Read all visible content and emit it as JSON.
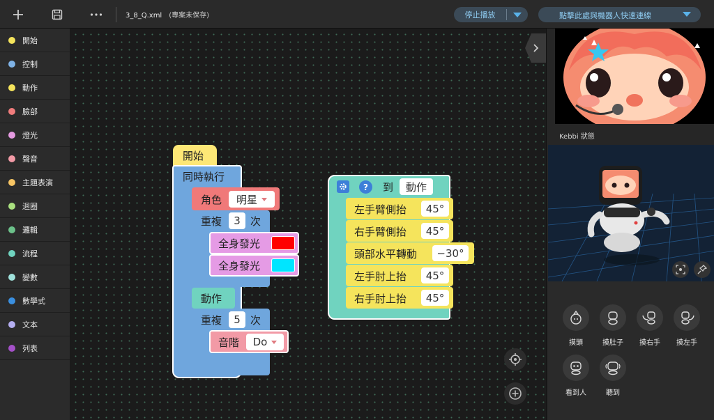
{
  "toolbar": {
    "add_icon": "plus-icon",
    "save_icon": "floppy-icon",
    "more_icon": "ellipsis-icon",
    "filename": "3_8_Q.xml",
    "save_status": "(專案未保存)",
    "stop_label": "停止播放",
    "connect_label": "點擊此處與機器人快速連線"
  },
  "sidebar": {
    "items": [
      {
        "label": "開始",
        "color": "#f5e45c"
      },
      {
        "label": "控制",
        "color": "#7fb2e5"
      },
      {
        "label": "動作",
        "color": "#f5e45c"
      },
      {
        "label": "臉部",
        "color": "#f07c7c"
      },
      {
        "label": "燈光",
        "color": "#e49ae0"
      },
      {
        "label": "聲音",
        "color": "#f29aa6"
      },
      {
        "label": "主題表演",
        "color": "#f7c564"
      },
      {
        "label": "迴圈",
        "color": "#a9e07f"
      },
      {
        "label": "邏輯",
        "color": "#6cc18a"
      },
      {
        "label": "流程",
        "color": "#70d3bf"
      },
      {
        "label": "變數",
        "color": "#9fe1db"
      },
      {
        "label": "數學式",
        "color": "#3a8fe0"
      },
      {
        "label": "文本",
        "color": "#b4aef0"
      },
      {
        "label": "列表",
        "color": "#a450c8"
      }
    ]
  },
  "blocks": {
    "start": "開始",
    "parallel": "同時執行",
    "role_label": "角色",
    "role_value": "明星",
    "repeat1_label": "重複",
    "repeat1_count": "3",
    "repeat1_unit": "次",
    "light1_label": "全身發光",
    "light1_color": "#ff0000",
    "light2_label": "全身發光",
    "light2_color": "#00e5ff",
    "action_label": "動作",
    "repeat2_label": "重複",
    "repeat2_count": "5",
    "repeat2_unit": "次",
    "note_label": "音階",
    "note_value": "Do"
  },
  "function_block": {
    "to_label": "到",
    "name": "動作",
    "steps": [
      {
        "label": "左手臂側抬",
        "value": "45°"
      },
      {
        "label": "右手臂側抬",
        "value": "45°"
      },
      {
        "label": "頭部水平轉動",
        "value": "−30°"
      },
      {
        "label": "左手肘上抬",
        "value": "45°"
      },
      {
        "label": "右手肘上抬",
        "value": "45°"
      }
    ]
  },
  "right_panel": {
    "status_label": "Kebbi 狀態",
    "sensors": [
      {
        "label": "摸頭",
        "icon": "touch-head-icon"
      },
      {
        "label": "摸肚子",
        "icon": "touch-belly-icon"
      },
      {
        "label": "摸右手",
        "icon": "touch-right-hand-icon"
      },
      {
        "label": "摸左手",
        "icon": "touch-left-hand-icon"
      },
      {
        "label": "看到人",
        "icon": "see-person-icon"
      },
      {
        "label": "聽到",
        "icon": "hear-icon"
      }
    ]
  }
}
